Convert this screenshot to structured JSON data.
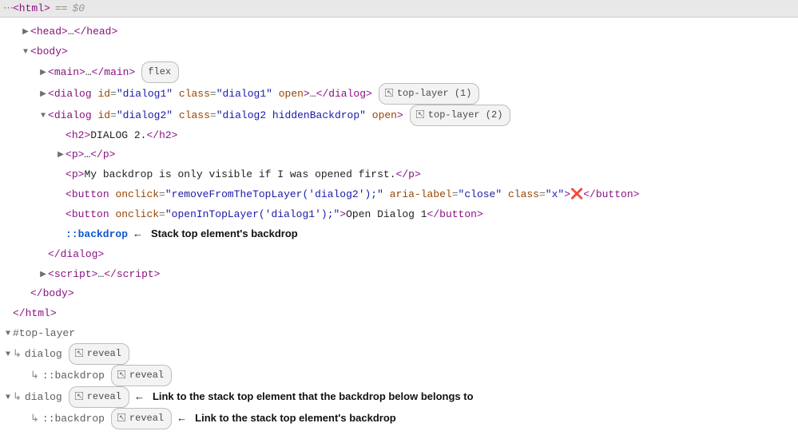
{
  "topbar": {
    "ellipsis": "⋯",
    "root": "<html>",
    "eq": "==",
    "var": "$0"
  },
  "tree": {
    "head": {
      "open": "<",
      "name": "head",
      "close": ">",
      "dots": "…",
      "end_open": "</",
      "end_close": ">"
    },
    "body": {
      "name": "body"
    },
    "main": {
      "name": "main",
      "dots": "…",
      "flex_badge": "flex"
    },
    "dialog1": {
      "name": "dialog",
      "attrs": {
        "id_name": "id",
        "id_val": "\"dialog1\"",
        "class_name": "class",
        "class_val": "\"dialog1\"",
        "open_name": "open"
      },
      "dots": "…",
      "badge": "top-layer (1)"
    },
    "dialog2": {
      "name": "dialog",
      "attrs": {
        "id_name": "id",
        "id_val": "\"dialog2\"",
        "class_name": "class",
        "class_val": "\"dialog2 hiddenBackdrop\"",
        "open_name": "open"
      },
      "badge": "top-layer (2)",
      "h2": {
        "name": "h2",
        "text": "DIALOG 2."
      },
      "p1": {
        "name": "p",
        "dots": "…"
      },
      "p2": {
        "name": "p",
        "text": "My backdrop is only visible if I was opened first."
      },
      "btn1": {
        "name": "button",
        "onclick_name": "onclick",
        "onclick_val": "\"removeFromTheTopLayer('dialog2');\"",
        "aria_name": "aria-label",
        "aria_val": "\"close\"",
        "class_name": "class",
        "class_val": "\"x\"",
        "text": "❌"
      },
      "btn2": {
        "name": "button",
        "onclick_name": "onclick",
        "onclick_val": "\"openInTopLayer('dialog1');\"",
        "text": "Open Dialog 1"
      },
      "backdrop": {
        "name": "::backdrop",
        "anno_arrow": "←",
        "anno": "Stack top element's backdrop"
      }
    },
    "script": {
      "name": "script",
      "dots": "…"
    },
    "close_body": "body",
    "close_html": "html"
  },
  "toplayer": {
    "header": "#top-layer",
    "item1": {
      "name": "dialog",
      "reveal": "reveal",
      "bd": "::backdrop"
    },
    "item2": {
      "name": "dialog",
      "reveal": "reveal",
      "bd": "::backdrop",
      "anno_arrow": "←",
      "anno1": "Link to the stack top element that the backdrop below belongs to",
      "anno2": "Link to the stack top element's backdrop"
    }
  },
  "sym": {
    "rarrow": "↳",
    "right": "▶",
    "down": "▼"
  }
}
